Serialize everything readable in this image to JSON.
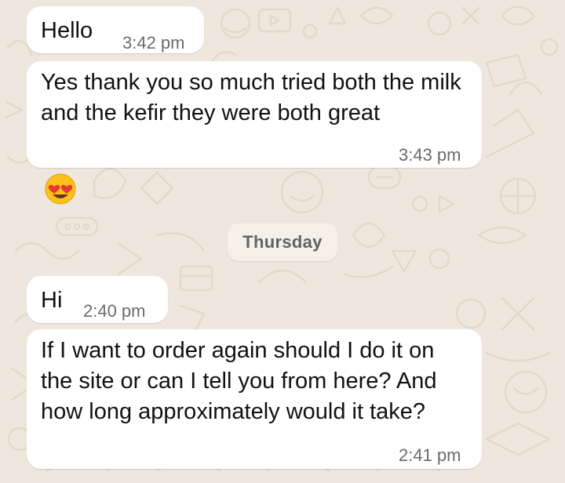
{
  "messages": [
    {
      "text": "Hello",
      "time": "3:42 pm"
    },
    {
      "text": "Yes thank you so much tried both the milk and the kefir they were both great",
      "time": "3:43 pm"
    },
    {
      "emoji": "heart-eyes-emoji"
    },
    {
      "text": "Hi",
      "time": "2:40 pm"
    },
    {
      "text": "If I want to order again should I do it on the site or can I tell you from here? And how long approximately would it take?",
      "time": "2:41 pm"
    }
  ],
  "date_separator": "Thursday",
  "colors": {
    "wallpaper": "#efe7dd",
    "bubble": "#ffffff",
    "time_text": "#6b6b6b",
    "chip": "#f6f1e8"
  }
}
